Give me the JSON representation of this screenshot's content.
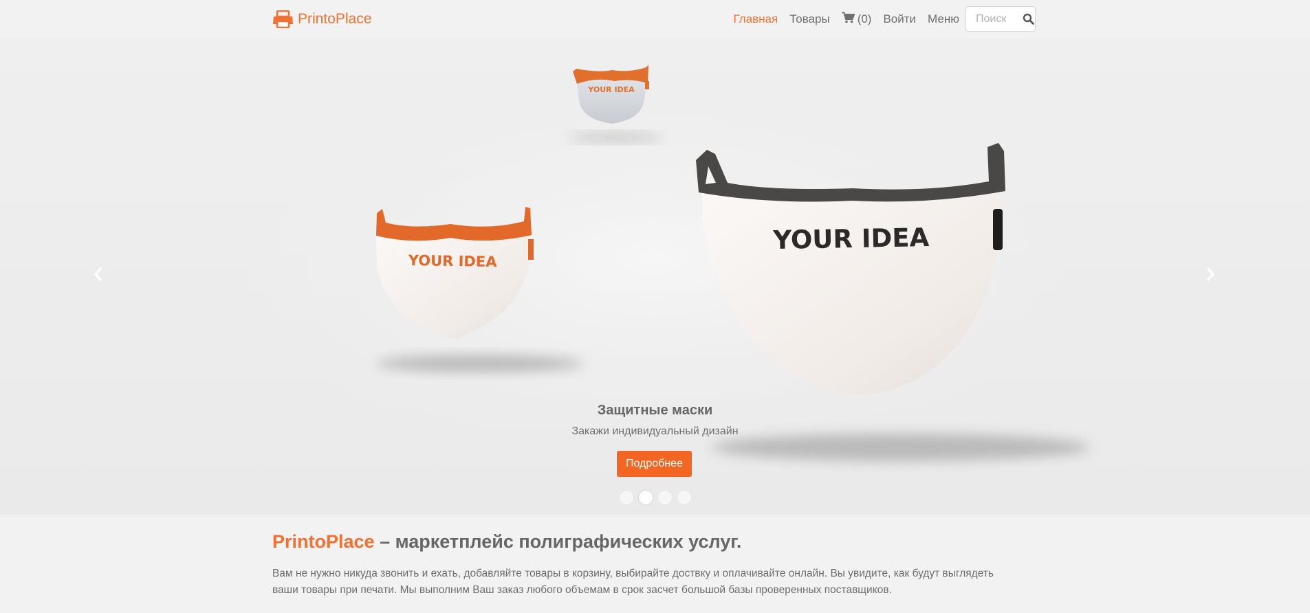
{
  "colors": {
    "accent": "#f07132",
    "button": "#f26522",
    "text": "#666666"
  },
  "nav": {
    "brand": "PrintoPlace",
    "brand_icon": "printer-icon",
    "home": "Главная",
    "products": "Товары",
    "cart_count": "(0)",
    "cart_icon": "shopping-cart-icon",
    "login": "Войти",
    "menu": "Меню",
    "search_placeholder": "Поиск",
    "search_icon": "search-icon"
  },
  "carousel": {
    "mask_print": "YOUR IDEA",
    "title": "Защитные маски",
    "subtitle": "Закажи индивидуальный дизайн",
    "button": "Подробнее",
    "slide_count": 4,
    "active_slide": 2,
    "prev_icon": "chevron-left-icon",
    "next_icon": "chevron-right-icon"
  },
  "intro": {
    "brand": "PrintoPlace",
    "heading_rest": " – маркетплейс полиграфических услуг.",
    "text": "Вам не нужно никуда звонить и ехать, добавляйте товары в корзину, выбирайте доствку и оплачивайте онлайн. Вы увидите, как будут выглядеть ваши товары при печати. Мы выполним Ваш заказ любого объемам в срок засчет большой базы проверенных поставщиков."
  }
}
